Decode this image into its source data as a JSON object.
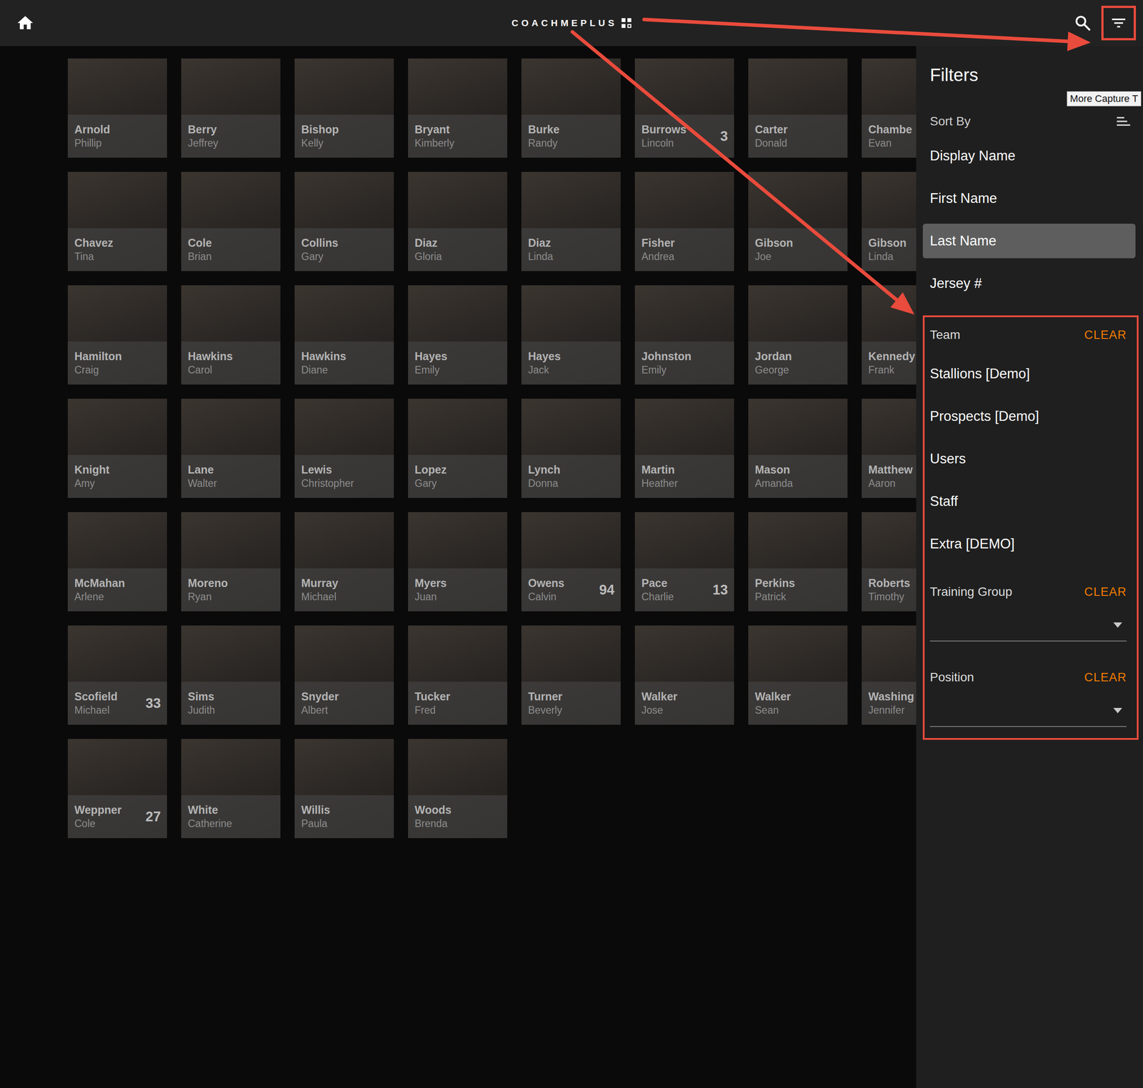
{
  "header": {
    "logo": "COACHMEPLUS"
  },
  "tooltip": "More Capture T",
  "people": [
    {
      "last": "Arnold",
      "first": "Phillip"
    },
    {
      "last": "Berry",
      "first": "Jeffrey"
    },
    {
      "last": "Bishop",
      "first": "Kelly"
    },
    {
      "last": "Bryant",
      "first": "Kimberly"
    },
    {
      "last": "Burke",
      "first": "Randy"
    },
    {
      "last": "Burrows",
      "first": "Lincoln",
      "number": "3"
    },
    {
      "last": "Carter",
      "first": "Donald"
    },
    {
      "last": "Chambe",
      "first": "Evan"
    },
    {
      "last": "Chavez",
      "first": "Tina"
    },
    {
      "last": "Cole",
      "first": "Brian"
    },
    {
      "last": "Collins",
      "first": "Gary"
    },
    {
      "last": "Diaz",
      "first": "Gloria"
    },
    {
      "last": "Diaz",
      "first": "Linda"
    },
    {
      "last": "Fisher",
      "first": "Andrea"
    },
    {
      "last": "Gibson",
      "first": "Joe"
    },
    {
      "last": "Gibson",
      "first": "Linda"
    },
    {
      "last": "Hamilton",
      "first": "Craig"
    },
    {
      "last": "Hawkins",
      "first": "Carol"
    },
    {
      "last": "Hawkins",
      "first": "Diane"
    },
    {
      "last": "Hayes",
      "first": "Emily"
    },
    {
      "last": "Hayes",
      "first": "Jack"
    },
    {
      "last": "Johnston",
      "first": "Emily"
    },
    {
      "last": "Jordan",
      "first": "George"
    },
    {
      "last": "Kennedy",
      "first": "Frank"
    },
    {
      "last": "Knight",
      "first": "Amy"
    },
    {
      "last": "Lane",
      "first": "Walter"
    },
    {
      "last": "Lewis",
      "first": "Christopher"
    },
    {
      "last": "Lopez",
      "first": "Gary"
    },
    {
      "last": "Lynch",
      "first": "Donna"
    },
    {
      "last": "Martin",
      "first": "Heather"
    },
    {
      "last": "Mason",
      "first": "Amanda"
    },
    {
      "last": "Matthew",
      "first": "Aaron"
    },
    {
      "last": "McMahan",
      "first": "Arlene"
    },
    {
      "last": "Moreno",
      "first": "Ryan"
    },
    {
      "last": "Murray",
      "first": "Michael"
    },
    {
      "last": "Myers",
      "first": "Juan"
    },
    {
      "last": "Owens",
      "first": "Calvin",
      "number": "94"
    },
    {
      "last": "Pace",
      "first": "Charlie",
      "number": "13"
    },
    {
      "last": "Perkins",
      "first": "Patrick"
    },
    {
      "last": "Roberts",
      "first": "Timothy"
    },
    {
      "last": "Scofield",
      "first": "Michael",
      "number": "33"
    },
    {
      "last": "Sims",
      "first": "Judith"
    },
    {
      "last": "Snyder",
      "first": "Albert"
    },
    {
      "last": "Tucker",
      "first": "Fred"
    },
    {
      "last": "Turner",
      "first": "Beverly"
    },
    {
      "last": "Walker",
      "first": "Jose"
    },
    {
      "last": "Walker",
      "first": "Sean"
    },
    {
      "last": "Washing",
      "first": "Jennifer"
    },
    {
      "last": "Weppner",
      "first": "Cole",
      "number": "27"
    },
    {
      "last": "White",
      "first": "Catherine"
    },
    {
      "last": "Willis",
      "first": "Paula"
    },
    {
      "last": "Woods",
      "first": "Brenda"
    }
  ],
  "filters": {
    "title": "Filters",
    "sort_label": "Sort By",
    "sort_options": [
      {
        "label": "Display Name",
        "selected": false
      },
      {
        "label": "First Name",
        "selected": false
      },
      {
        "label": "Last Name",
        "selected": true
      },
      {
        "label": "Jersey #",
        "selected": false
      }
    ],
    "team": {
      "label": "Team",
      "clear": "CLEAR",
      "items": [
        {
          "label": "Stallions [Demo]",
          "selected": false
        },
        {
          "label": "Prospects [Demo]",
          "selected": false
        },
        {
          "label": "Users",
          "selected": false
        },
        {
          "label": "Staff",
          "selected": false
        },
        {
          "label": "Extra [DEMO]",
          "selected": false
        }
      ]
    },
    "training_group": {
      "label": "Training Group",
      "clear": "CLEAR"
    },
    "position": {
      "label": "Position",
      "clear": "CLEAR"
    }
  }
}
